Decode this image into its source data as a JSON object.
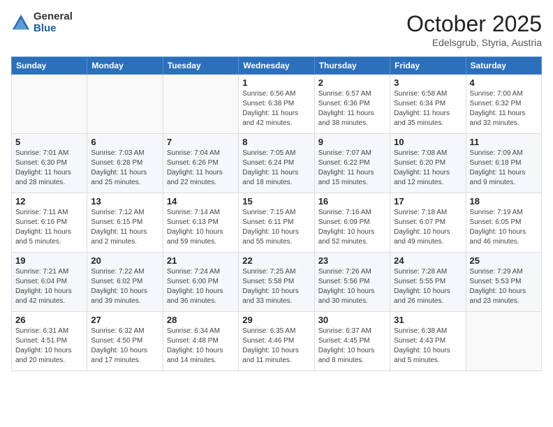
{
  "logo": {
    "general": "General",
    "blue": "Blue"
  },
  "header": {
    "month": "October 2025",
    "location": "Edelsgrub, Styria, Austria"
  },
  "weekdays": [
    "Sunday",
    "Monday",
    "Tuesday",
    "Wednesday",
    "Thursday",
    "Friday",
    "Saturday"
  ],
  "weeks": [
    [
      {
        "day": "",
        "info": ""
      },
      {
        "day": "",
        "info": ""
      },
      {
        "day": "",
        "info": ""
      },
      {
        "day": "1",
        "info": "Sunrise: 6:56 AM\nSunset: 6:38 PM\nDaylight: 11 hours\nand 42 minutes."
      },
      {
        "day": "2",
        "info": "Sunrise: 6:57 AM\nSunset: 6:36 PM\nDaylight: 11 hours\nand 38 minutes."
      },
      {
        "day": "3",
        "info": "Sunrise: 6:58 AM\nSunset: 6:34 PM\nDaylight: 11 hours\nand 35 minutes."
      },
      {
        "day": "4",
        "info": "Sunrise: 7:00 AM\nSunset: 6:32 PM\nDaylight: 11 hours\nand 32 minutes."
      }
    ],
    [
      {
        "day": "5",
        "info": "Sunrise: 7:01 AM\nSunset: 6:30 PM\nDaylight: 11 hours\nand 28 minutes."
      },
      {
        "day": "6",
        "info": "Sunrise: 7:03 AM\nSunset: 6:28 PM\nDaylight: 11 hours\nand 25 minutes."
      },
      {
        "day": "7",
        "info": "Sunrise: 7:04 AM\nSunset: 6:26 PM\nDaylight: 11 hours\nand 22 minutes."
      },
      {
        "day": "8",
        "info": "Sunrise: 7:05 AM\nSunset: 6:24 PM\nDaylight: 11 hours\nand 18 minutes."
      },
      {
        "day": "9",
        "info": "Sunrise: 7:07 AM\nSunset: 6:22 PM\nDaylight: 11 hours\nand 15 minutes."
      },
      {
        "day": "10",
        "info": "Sunrise: 7:08 AM\nSunset: 6:20 PM\nDaylight: 11 hours\nand 12 minutes."
      },
      {
        "day": "11",
        "info": "Sunrise: 7:09 AM\nSunset: 6:18 PM\nDaylight: 11 hours\nand 9 minutes."
      }
    ],
    [
      {
        "day": "12",
        "info": "Sunrise: 7:11 AM\nSunset: 6:16 PM\nDaylight: 11 hours\nand 5 minutes."
      },
      {
        "day": "13",
        "info": "Sunrise: 7:12 AM\nSunset: 6:15 PM\nDaylight: 11 hours\nand 2 minutes."
      },
      {
        "day": "14",
        "info": "Sunrise: 7:14 AM\nSunset: 6:13 PM\nDaylight: 10 hours\nand 59 minutes."
      },
      {
        "day": "15",
        "info": "Sunrise: 7:15 AM\nSunset: 6:11 PM\nDaylight: 10 hours\nand 55 minutes."
      },
      {
        "day": "16",
        "info": "Sunrise: 7:16 AM\nSunset: 6:09 PM\nDaylight: 10 hours\nand 52 minutes."
      },
      {
        "day": "17",
        "info": "Sunrise: 7:18 AM\nSunset: 6:07 PM\nDaylight: 10 hours\nand 49 minutes."
      },
      {
        "day": "18",
        "info": "Sunrise: 7:19 AM\nSunset: 6:05 PM\nDaylight: 10 hours\nand 46 minutes."
      }
    ],
    [
      {
        "day": "19",
        "info": "Sunrise: 7:21 AM\nSunset: 6:04 PM\nDaylight: 10 hours\nand 42 minutes."
      },
      {
        "day": "20",
        "info": "Sunrise: 7:22 AM\nSunset: 6:02 PM\nDaylight: 10 hours\nand 39 minutes."
      },
      {
        "day": "21",
        "info": "Sunrise: 7:24 AM\nSunset: 6:00 PM\nDaylight: 10 hours\nand 36 minutes."
      },
      {
        "day": "22",
        "info": "Sunrise: 7:25 AM\nSunset: 5:58 PM\nDaylight: 10 hours\nand 33 minutes."
      },
      {
        "day": "23",
        "info": "Sunrise: 7:26 AM\nSunset: 5:56 PM\nDaylight: 10 hours\nand 30 minutes."
      },
      {
        "day": "24",
        "info": "Sunrise: 7:28 AM\nSunset: 5:55 PM\nDaylight: 10 hours\nand 26 minutes."
      },
      {
        "day": "25",
        "info": "Sunrise: 7:29 AM\nSunset: 5:53 PM\nDaylight: 10 hours\nand 23 minutes."
      }
    ],
    [
      {
        "day": "26",
        "info": "Sunrise: 6:31 AM\nSunset: 4:51 PM\nDaylight: 10 hours\nand 20 minutes."
      },
      {
        "day": "27",
        "info": "Sunrise: 6:32 AM\nSunset: 4:50 PM\nDaylight: 10 hours\nand 17 minutes."
      },
      {
        "day": "28",
        "info": "Sunrise: 6:34 AM\nSunset: 4:48 PM\nDaylight: 10 hours\nand 14 minutes."
      },
      {
        "day": "29",
        "info": "Sunrise: 6:35 AM\nSunset: 4:46 PM\nDaylight: 10 hours\nand 11 minutes."
      },
      {
        "day": "30",
        "info": "Sunrise: 6:37 AM\nSunset: 4:45 PM\nDaylight: 10 hours\nand 8 minutes."
      },
      {
        "day": "31",
        "info": "Sunrise: 6:38 AM\nSunset: 4:43 PM\nDaylight: 10 hours\nand 5 minutes."
      },
      {
        "day": "",
        "info": ""
      }
    ]
  ]
}
